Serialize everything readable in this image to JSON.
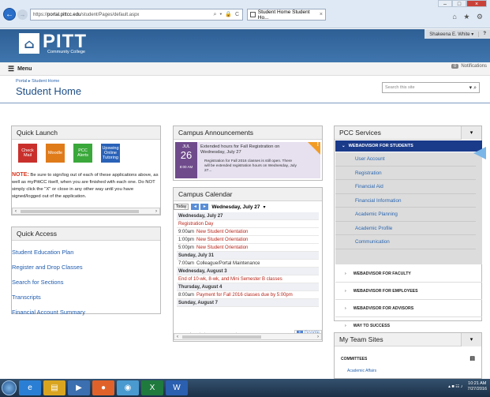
{
  "browser": {
    "url_prefix": "https://",
    "url_domain": "portal.pittcc.edu",
    "url_path": "/student/Pages/default.aspx",
    "address_icons": "⌕ ▾ 🔒 C",
    "tab_title": "Student Home Student Ho...",
    "tab_close": "×",
    "back_icon": "←",
    "forward_icon": "→",
    "window_controls": [
      "–",
      "□",
      "×"
    ],
    "toolbar_icons": "⌂ ★ ⚙"
  },
  "banner": {
    "logo_mark": "⌂",
    "logo_name": "PITT",
    "logo_sub": "Community College",
    "user_name": "Shakeena E. White ▾",
    "help": "?"
  },
  "menubar": {
    "hamburger": "☰",
    "label": "Menu",
    "notifications_count": "0",
    "notifications_label": "Notifications"
  },
  "page": {
    "breadcrumb": "Portal ▸ Student Home",
    "title": "Student Home",
    "search_placeholder": "Search this site",
    "search_icons": "▾ ⌕"
  },
  "quick_launch": {
    "title": "Quick Launch",
    "tiles": [
      {
        "label": "Check Mail",
        "color": "#c9302c"
      },
      {
        "label": "Moodle",
        "color": "#e07b1a"
      },
      {
        "label": "PCC Alerts",
        "color": "#3aa83a"
      },
      {
        "label": "Upswing Online Tutoring",
        "color": "#2a62b8"
      }
    ],
    "note_label": "NOTE:",
    "note_text": " Be sure to sign/log out of each of these applications above, as well as myPittCC itself, when you are finished with each one. Do NOT simply click the \"X\" or close in any other way until you have signed/logged out of the application."
  },
  "quick_access": {
    "title": "Quick Access",
    "links": [
      "Student Education Plan",
      "Register and Drop Classes",
      "Search for Sections",
      "Transcripts",
      "Financial Account Summary"
    ]
  },
  "announcements": {
    "title": "Campus Announcements",
    "month": "JUL",
    "day": "26",
    "time": "8:00 AM",
    "item_title": "Extended hours for Fall Registration on Wednesday, July 27",
    "item_body": "Registration for Fall 2016 classes is still open. There will be extended registration hours on Wednesday, July 27...",
    "flag_mark": "!"
  },
  "calendar": {
    "title": "Campus Calendar",
    "today_label": "Today",
    "prev_icon": "◂",
    "next_icon": "▸",
    "current_date": "Wednesday, July 27",
    "date_dropdown": "▾",
    "rows": [
      {
        "kind": "day",
        "text": "Wednesday, July 27"
      },
      {
        "kind": "allday",
        "text": "Registration Day"
      },
      {
        "kind": "event",
        "time": "9:00am",
        "text": "New Student Orientation"
      },
      {
        "kind": "event",
        "time": "1:00pm",
        "text": "New Student Orientation"
      },
      {
        "kind": "event",
        "time": "5:00pm",
        "text": "New Student Orientation"
      },
      {
        "kind": "day",
        "text": "Sunday, July 31"
      },
      {
        "kind": "event",
        "time": "7:00am",
        "text": "Colleague/Portal Maintenance",
        "plain": true
      },
      {
        "kind": "day",
        "text": "Wednesday, August 3"
      },
      {
        "kind": "allday",
        "text": "End of 10-wk, 8-wk, and Mini Semester B classes"
      },
      {
        "kind": "day",
        "text": "Thursday, August 4"
      },
      {
        "kind": "event",
        "time": "8:00am",
        "text": "Payment for Fall 2016 classes due by 5:00pm"
      },
      {
        "kind": "day",
        "text": "Sunday, August 7"
      }
    ],
    "footer": "Events shown in time zone: Eastern Time",
    "gcal_plus": "+",
    "gcal_label": "Google"
  },
  "services": {
    "title": "PCC Services",
    "dropdown": "▾",
    "active_group": "WEBADVISOR FOR STUDENTS",
    "active_chevron": "⌄",
    "sub_items": [
      "User Account",
      "Registration",
      "Financial Aid",
      "Financial Information",
      "Academic Planning",
      "Academic Profile",
      "Communication"
    ],
    "groups": [
      "WEBADVISOR FOR FACULTY",
      "WEBADVISOR FOR EMPLOYEES",
      "WEBADVISOR FOR ADVISORS",
      "WAY TO SUCCESS"
    ],
    "group_chevron": "›"
  },
  "team_sites": {
    "title": "My Team Sites",
    "dropdown": "▾",
    "section": "COMMITTEES",
    "section_icon": "▤",
    "items": [
      "Academic Affairs"
    ]
  },
  "taskbar": {
    "apps": [
      {
        "name": "ie-icon",
        "glyph": "e",
        "color": "#2a7fd4"
      },
      {
        "name": "explorer-icon",
        "glyph": "▤",
        "color": "#d9a521"
      },
      {
        "name": "media-icon",
        "glyph": "▶",
        "color": "#3b6fb0"
      },
      {
        "name": "firefox-icon",
        "glyph": "●",
        "color": "#e0622a"
      },
      {
        "name": "chrome-icon",
        "glyph": "◉",
        "color": "#4a9ad0"
      },
      {
        "name": "excel-icon",
        "glyph": "X",
        "color": "#1f7a3e"
      },
      {
        "name": "word-icon",
        "glyph": "W",
        "color": "#2b5fb0"
      }
    ],
    "tray_icons": "▴ ■ ☷ ♪",
    "time": "10:21 AM",
    "date": "7/27/2016"
  }
}
